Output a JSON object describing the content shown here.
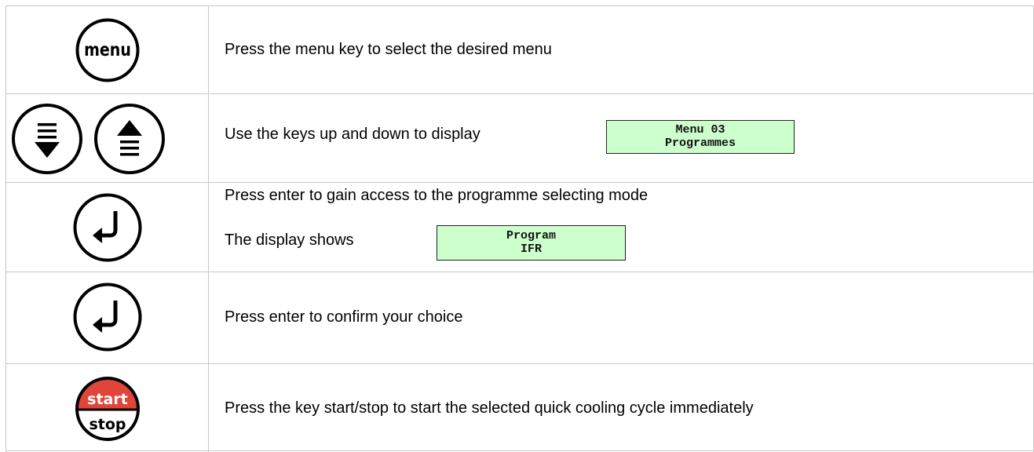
{
  "rows": [
    {
      "text": "Press the menu key to select the desired menu",
      "key_label": "menu",
      "icon": "menu-key-icon"
    },
    {
      "text": "Use the keys up and down to display",
      "display": {
        "line1": "Menu 03",
        "line2": "Programmes"
      },
      "icons": [
        "down-key-icon",
        "up-key-icon"
      ]
    },
    {
      "text": "Press enter to gain access to the programme selecting mode",
      "text2": "The display shows",
      "display": {
        "line1": "Program",
        "line2": "IFR"
      },
      "icon": "enter-key-icon"
    },
    {
      "text": "Press enter to confirm your choice",
      "icon": "enter-key-icon"
    },
    {
      "text": "Press the key start/stop to start the selected quick cooling cycle immediately",
      "key_top": "start",
      "key_bottom": "stop",
      "icon": "start-stop-key-icon",
      "accent": "#e0453a"
    }
  ]
}
